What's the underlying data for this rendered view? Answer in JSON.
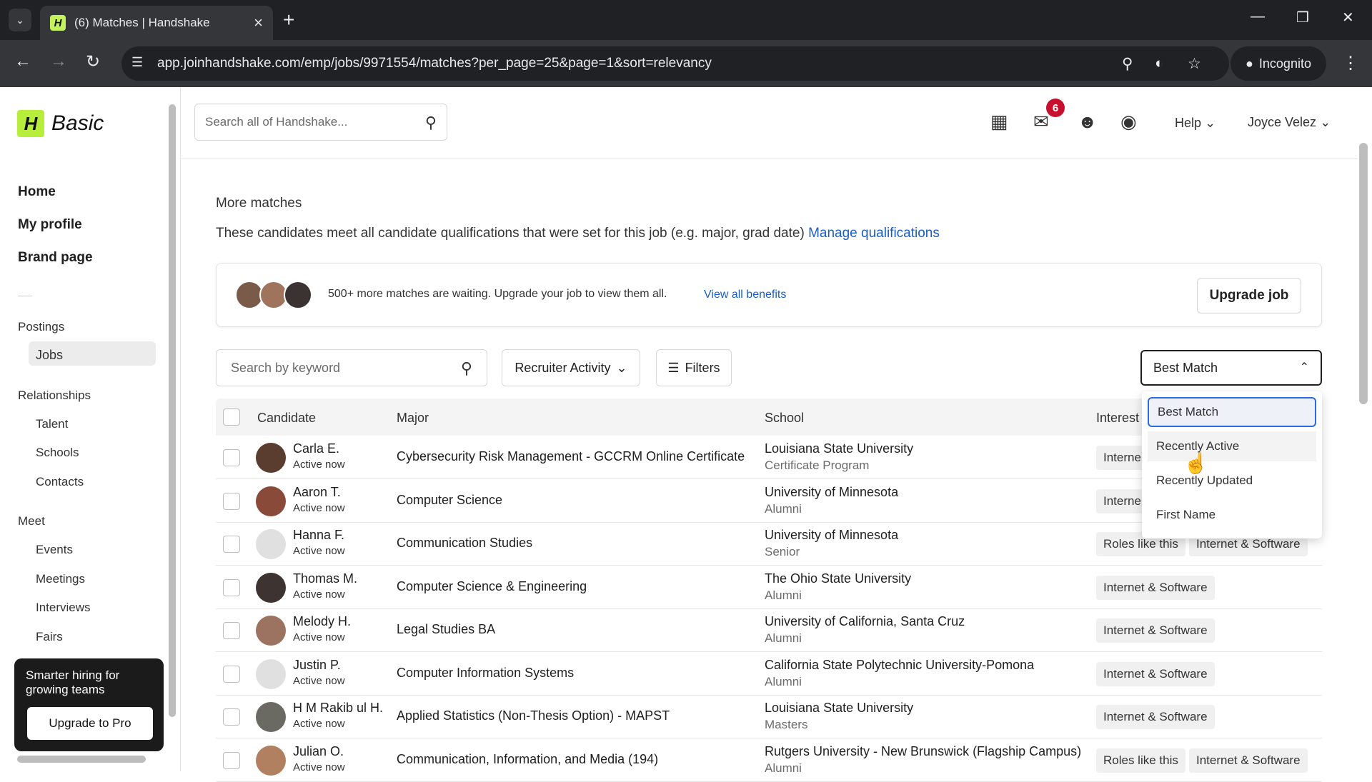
{
  "browser": {
    "tab_title": "(6) Matches | Handshake",
    "favicon_letter": "H",
    "url": "app.joinhandshake.com/emp/jobs/9971554/matches?per_page=25&page=1&sort=relevancy",
    "incognito_label": "Incognito"
  },
  "sidebar": {
    "logo_letter": "H",
    "logo_text": "Basic",
    "main_items": [
      "Home",
      "My profile",
      "Brand page"
    ],
    "postings_label": "Postings",
    "jobs_label": "Jobs",
    "relationships_label": "Relationships",
    "relationship_items": [
      "Talent",
      "Schools",
      "Contacts"
    ],
    "meet_label": "Meet",
    "meet_items": [
      "Events",
      "Meetings",
      "Interviews",
      "Fairs"
    ],
    "promo_text": "Smarter hiring for growing teams",
    "promo_button": "Upgrade to Pro"
  },
  "header": {
    "search_placeholder": "Search all of Handshake...",
    "notification_count": "6",
    "help_label": "Help",
    "user_name": "Joyce Velez"
  },
  "main": {
    "section_title": "More matches",
    "description": "These candidates meet all candidate qualifications that were set for this job (e.g. major, grad date)",
    "manage_link": "Manage qualifications",
    "banner_text": "500+ more matches are waiting. Upgrade your job to view them all.",
    "banner_link": "View all benefits",
    "upgrade_button": "Upgrade job",
    "keyword_placeholder": "Search by keyword",
    "recruiter_activity": "Recruiter Activity",
    "filters_label": "Filters",
    "sort_value": "Best Match"
  },
  "table": {
    "headers": [
      "Candidate",
      "Major",
      "School",
      "Interest"
    ],
    "rows": [
      {
        "name": "Carla E.",
        "status": "Active now",
        "major": "Cybersecurity Risk Management - GCCRM Online Certificate",
        "school": "Louisiana State University",
        "level": "Certificate Program",
        "tags": [
          "Interne"
        ]
      },
      {
        "name": "Aaron T.",
        "status": "Active now",
        "major": "Computer Science",
        "school": "University of Minnesota",
        "level": "Alumni",
        "tags": [
          "Interne"
        ]
      },
      {
        "name": "Hanna F.",
        "status": "Active now",
        "major": "Communication Studies",
        "school": "University of Minnesota",
        "level": "Senior",
        "tags": [
          "Roles like this",
          "Internet & Software"
        ]
      },
      {
        "name": "Thomas M.",
        "status": "Active now",
        "major": "Computer Science & Engineering",
        "school": "The Ohio State University",
        "level": "Alumni",
        "tags": [
          "Internet & Software"
        ]
      },
      {
        "name": "Melody H.",
        "status": "Active now",
        "major": "Legal Studies BA",
        "school": "University of California, Santa Cruz",
        "level": "Alumni",
        "tags": [
          "Internet & Software"
        ]
      },
      {
        "name": "Justin P.",
        "status": "Active now",
        "major": "Computer Information Systems",
        "school": "California State Polytechnic University-Pomona",
        "level": "Alumni",
        "tags": [
          "Internet & Software"
        ]
      },
      {
        "name": "H M Rakib ul H.",
        "status": "Active now",
        "major": "Applied Statistics (Non-Thesis Option) - MAPST",
        "school": "Louisiana State University",
        "level": "Masters",
        "tags": [
          "Internet & Software"
        ]
      },
      {
        "name": "Julian O.",
        "status": "Active now",
        "major": "Communication, Information, and Media (194)",
        "school": "Rutgers University - New Brunswick (Flagship Campus)",
        "level": "Alumni",
        "tags": [
          "Roles like this",
          "Internet & Software"
        ]
      }
    ]
  },
  "sort_dropdown": {
    "options": [
      "Best Match",
      "Recently Active",
      "Recently Updated",
      "First Name"
    ],
    "selected": "Best Match",
    "hovered": "Recently Active"
  }
}
